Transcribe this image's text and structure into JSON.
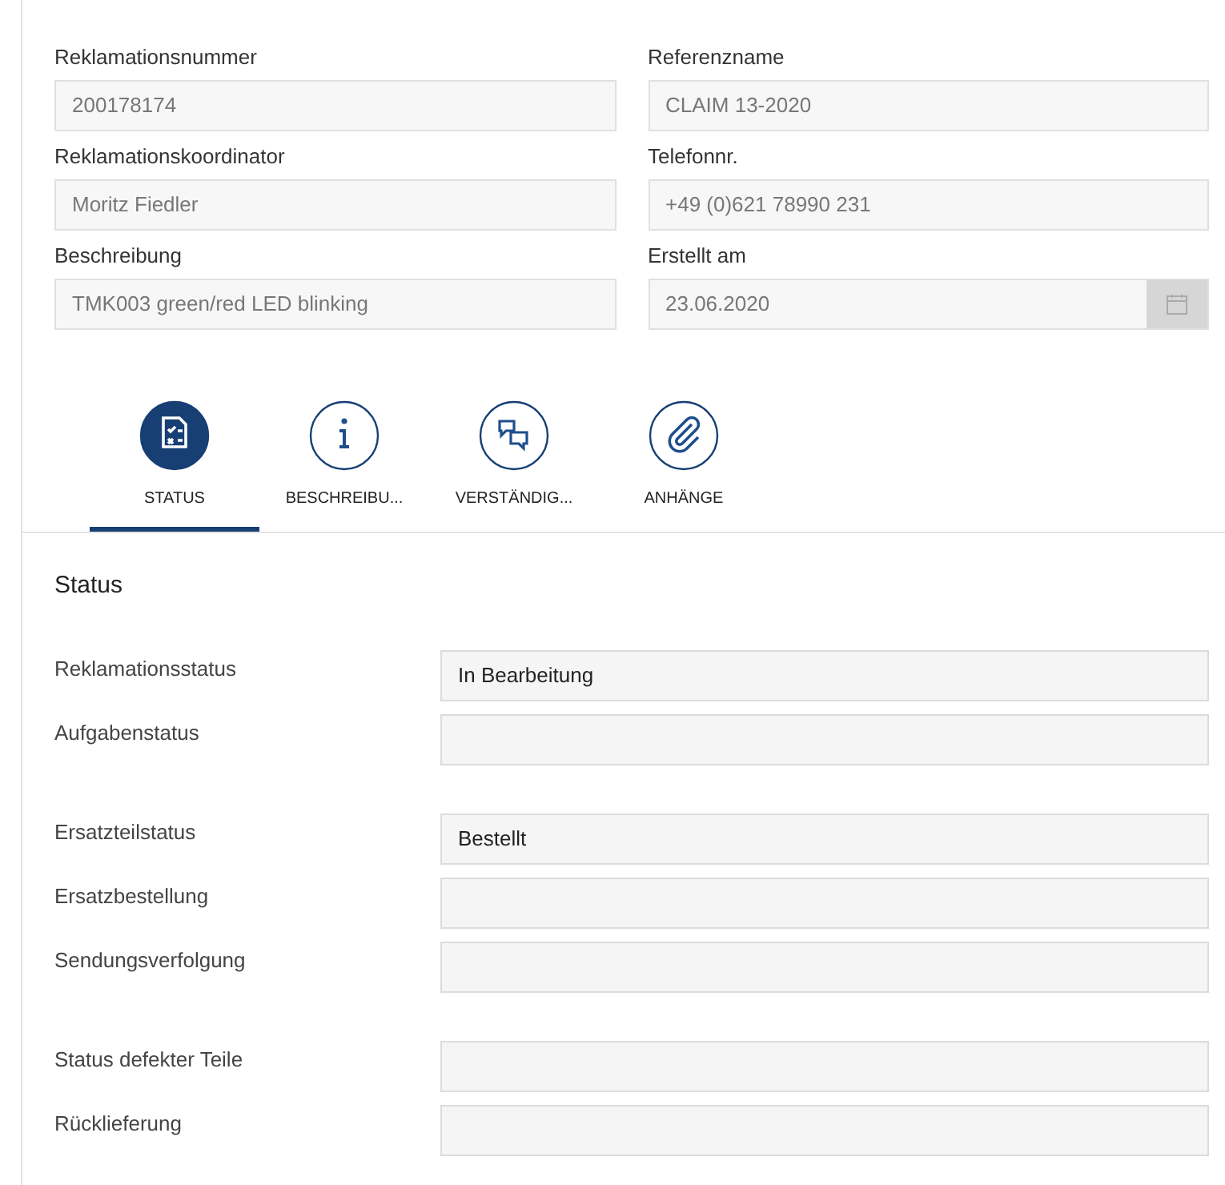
{
  "header_fields": [
    {
      "label": "Reklamationsnummer",
      "value": "200178174",
      "kind": "text",
      "disabled": true
    },
    {
      "label": "Referenzname",
      "value": "CLAIM 13-2020",
      "kind": "text",
      "disabled": true
    },
    {
      "label": "Reklamationskoordinator",
      "value": "Moritz Fiedler",
      "kind": "text",
      "disabled": true
    },
    {
      "label": "Telefonnr.",
      "value": "+49 (0)621 78990 231",
      "kind": "text",
      "disabled": true
    },
    {
      "label": "Beschreibung",
      "value": "TMK003 green/red LED blinking",
      "kind": "text",
      "disabled": true
    },
    {
      "label": "Erstellt am",
      "value": "23.06.2020",
      "kind": "date",
      "disabled": true
    }
  ],
  "tabs": [
    {
      "label": "STATUS",
      "kind": "checklist",
      "selected": true
    },
    {
      "label": "BESCHREIBU...",
      "kind": "info",
      "selected": false
    },
    {
      "label": "VERSTÄNDIG...",
      "kind": "chat",
      "selected": false
    },
    {
      "label": "ANHÄNGE",
      "kind": "paperclip",
      "selected": false
    }
  ],
  "section": {
    "title": "Status",
    "groups": [
      [
        {
          "label": "Reklamationsstatus",
          "value": "In Bearbeitung"
        },
        {
          "label": "Aufgabenstatus"
        }
      ],
      [
        {
          "label": "Ersatzteilstatus",
          "value": "Bestellt"
        },
        {
          "label": "Ersatzbestellung"
        },
        {
          "label": "Sendungsverfolgung"
        }
      ],
      [
        {
          "label": "Status defekter Teile"
        },
        {
          "label": "Rücklieferung"
        }
      ]
    ]
  }
}
